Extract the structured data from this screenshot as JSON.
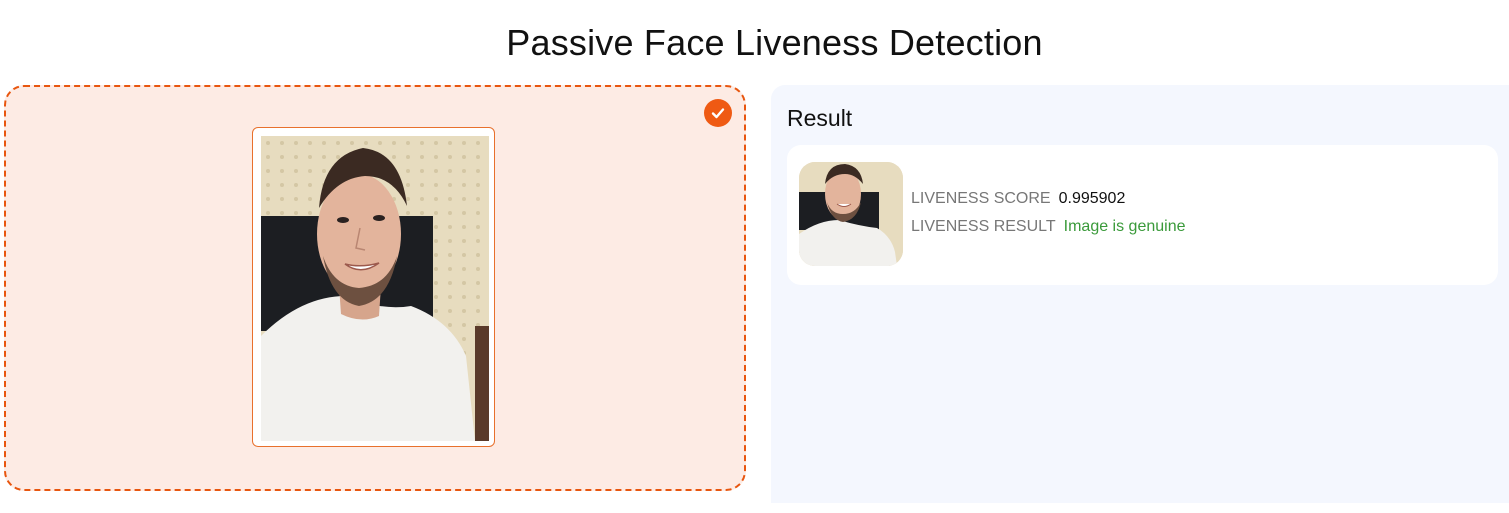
{
  "page": {
    "title": "Passive Face Liveness Detection"
  },
  "upload": {
    "status_icon": "check-circle-icon",
    "accent_color": "#ef5a13",
    "background_color": "#fdebe4",
    "preview_alt": "Uploaded selfie"
  },
  "result": {
    "heading": "Result",
    "thumbnail_alt": "Face thumbnail",
    "score_label": "LIVENESS SCORE",
    "score_value": "0.995902",
    "result_label": "LIVENESS RESULT",
    "result_value": "Image is genuine",
    "result_color": "#3a9a3a"
  }
}
